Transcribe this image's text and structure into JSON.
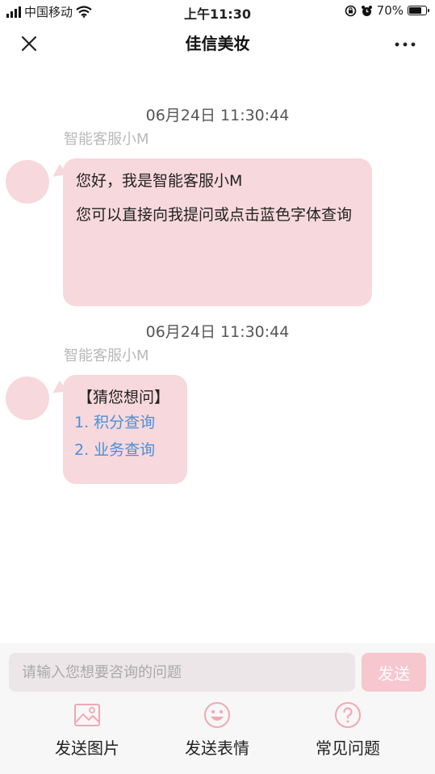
{
  "status_bar": {
    "carrier": "中国移动",
    "time": "上午11:30",
    "battery": "70%",
    "battery_level": 0.7,
    "icons": [
      "signal-icon",
      "wifi-icon",
      "rotation-lock-icon",
      "alarm-icon",
      "battery-icon"
    ]
  },
  "nav": {
    "title": "佳信美妆",
    "close_icon": "close-icon",
    "more_icon": "more-icon"
  },
  "chat": {
    "messages": [
      {
        "timestamp": "06月24日 11:30:44",
        "sender": "智能客服小M",
        "lines": [
          "您好，我是智能客服小M",
          "您可以直接向我提问或点击蓝色字体查询"
        ]
      },
      {
        "timestamp": "06月24日 11:30:44",
        "sender": "智能客服小M",
        "header": "【猜您想问】",
        "links": [
          "1. 积分查询",
          "2. 业务查询"
        ]
      }
    ]
  },
  "input": {
    "placeholder": "请输入您想要咨询的问题",
    "value": "",
    "send_label": "发送"
  },
  "toolbar": [
    {
      "label": "发送图片",
      "icon": "image-icon"
    },
    {
      "label": "发送表情",
      "icon": "emoji-icon"
    },
    {
      "label": "常见问题",
      "icon": "question-icon"
    }
  ],
  "colors": {
    "bubble": "#f7d8dc",
    "link": "#4a8fd8",
    "send_button": "#f6c7cf",
    "icon_pink": "#f0a8b5"
  }
}
